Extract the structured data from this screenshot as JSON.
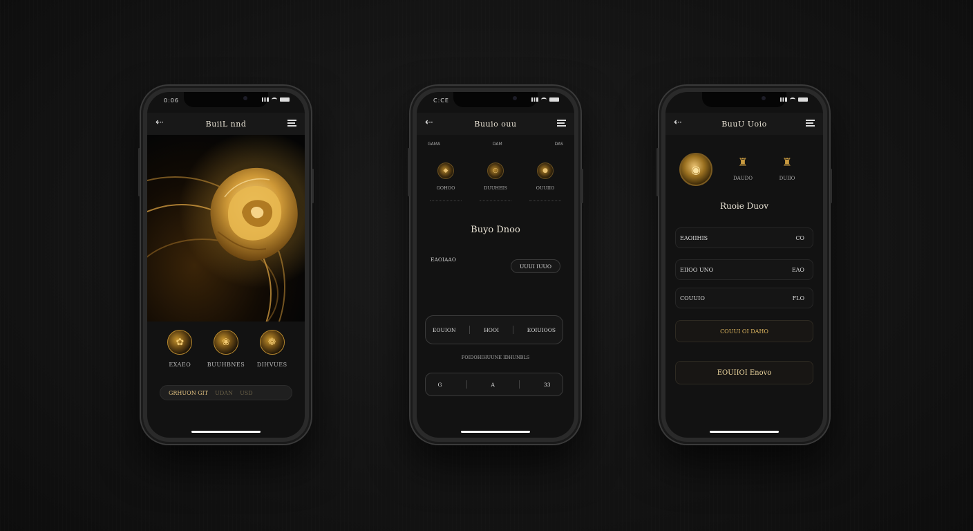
{
  "colors": {
    "accent_gold": "#c8962f",
    "background": "#141414",
    "text": "#e8e2d4"
  },
  "phone1": {
    "status_time": "0:06",
    "title": "BuiiL nnd",
    "icons": [
      "back-arrow-icon",
      "menu-icon"
    ],
    "circles": [
      {
        "label": "EXAEO",
        "icon": "rose-icon"
      },
      {
        "label": "BUUHBNES",
        "icon": "flame-icon"
      },
      {
        "label": "DIHVUES",
        "icon": "leaf-icon"
      }
    ],
    "pill": {
      "label": "GRHUON GIT",
      "dim1": "UDAN",
      "dim2": "USD"
    }
  },
  "phone2": {
    "status_time": "C:CE",
    "title": "Buuio ouu",
    "tiny_labels": [
      "GAMA",
      "DAM",
      "DAS"
    ],
    "circles": [
      {
        "label": "GOHOO",
        "icon": "gem-icon"
      },
      {
        "label": "DUUHEIS",
        "icon": "ring-icon"
      },
      {
        "label": "OUUIIO",
        "icon": "coin-icon"
      }
    ],
    "section_title": "Buyo Dnoo",
    "row_label": "EAOIAAO",
    "row_pill": "UUUI IUUO",
    "pill_segments": [
      "EOUION",
      "HOOI",
      "EOIUIOOS"
    ],
    "caption": "FOIDOHIHUUNE IDHUNBLS",
    "action_icons": [
      "G",
      "A",
      "33"
    ]
  },
  "phone3": {
    "status_time": "",
    "title": "BuuU Uoio",
    "circles": [
      {
        "label": "",
        "icon": "gold-coin-icon"
      },
      {
        "label": "DAUDO",
        "icon": "crown-icon"
      },
      {
        "label": "DUIIO",
        "icon": "crown-icon"
      }
    ],
    "section_title": "Ruoie Duov",
    "rows": [
      {
        "label": "EAOIIHIS",
        "value": "CO"
      },
      {
        "label": "EIIOO UNO",
        "value": "EAO"
      },
      {
        "label": "COUUIO",
        "value": "FLO"
      }
    ],
    "button1": "COUUI OI DAHO",
    "button2": "EOUIIOI Enovo"
  }
}
